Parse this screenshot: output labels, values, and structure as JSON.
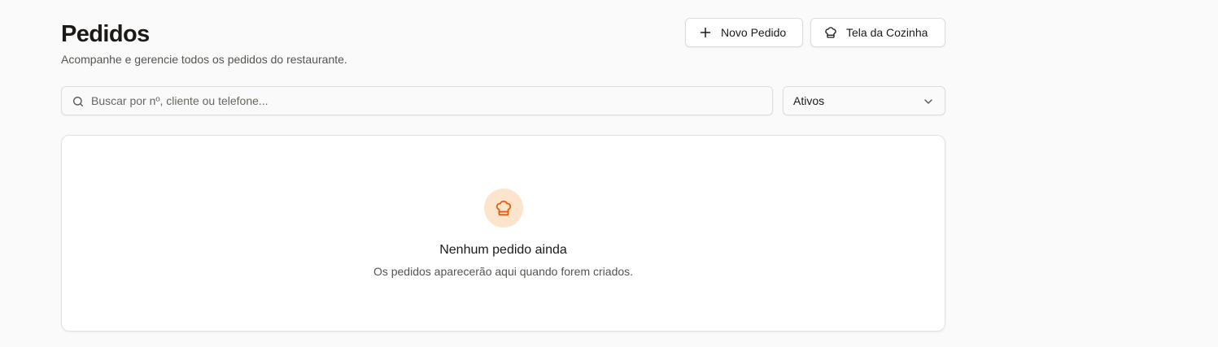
{
  "header": {
    "title": "Pedidos",
    "subtitle": "Acompanhe e gerencie todos os pedidos do restaurante."
  },
  "actions": {
    "new_order_label": "Novo Pedido",
    "new_order_icon": "plus-icon",
    "kitchen_label": "Tela da Cozinha",
    "kitchen_icon": "chef-hat-icon"
  },
  "filters": {
    "search": {
      "placeholder": "Buscar por nº, cliente ou telefone...",
      "value": "",
      "icon": "search-icon"
    },
    "status_select": {
      "selected": "Ativos",
      "icon": "chevron-down-icon"
    }
  },
  "empty_state": {
    "icon": "chef-hat-icon",
    "title": "Nenhum pedido ainda",
    "description": "Os pedidos aparecerão aqui quando forem criados."
  },
  "colors": {
    "background": "#fafafa",
    "accent": "#ea580c",
    "accent_soft": "#fde4cc",
    "text": "#1c1917",
    "muted_text": "#57534e"
  }
}
